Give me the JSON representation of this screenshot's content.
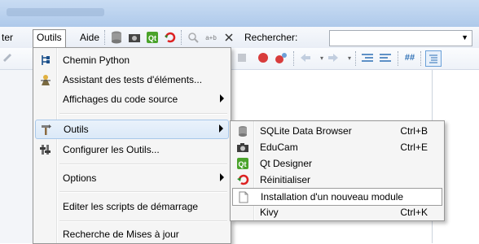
{
  "menubar": {
    "partial_item": "ter",
    "outils": "Outils",
    "aide": "Aide",
    "search_label": "Rechercher:"
  },
  "outils_menu": {
    "items": [
      {
        "label": "Chemin Python",
        "icon": "python-path-icon"
      },
      {
        "label": "Assistant des tests d'éléments...",
        "icon": "test-assistant-icon"
      },
      {
        "label": "Affichages du code source",
        "icon": "",
        "submenu": true
      },
      {
        "label": "Outils",
        "icon": "tools-icon",
        "submenu": true
      },
      {
        "label": "Configurer les Outils...",
        "icon": "configure-tools-icon"
      },
      {
        "label": "Options",
        "icon": "",
        "submenu": true
      },
      {
        "label": "Editer les scripts de démarrage",
        "icon": ""
      },
      {
        "label": "Recherche de Mises à jour",
        "icon": ""
      }
    ]
  },
  "outils_submenu": {
    "items": [
      {
        "label": "SQLite Data Browser",
        "shortcut": "Ctrl+B",
        "icon": "database-icon"
      },
      {
        "label": "EduCam",
        "shortcut": "Ctrl+E",
        "icon": "camera-icon"
      },
      {
        "label": "Qt Designer",
        "shortcut": "",
        "icon": "qt-icon"
      },
      {
        "label": "Réinitialiser",
        "shortcut": "",
        "icon": "reset-icon"
      },
      {
        "label": "Installation d'un nouveau module",
        "shortcut": "",
        "icon": "blank-page-icon"
      },
      {
        "label": "Kivy",
        "shortcut": "Ctrl+K",
        "icon": ""
      }
    ]
  },
  "colors": {
    "highlight": "#dbe9f8",
    "highlight_border": "#a8c8ea",
    "menu_bg": "#f5f5f5"
  }
}
